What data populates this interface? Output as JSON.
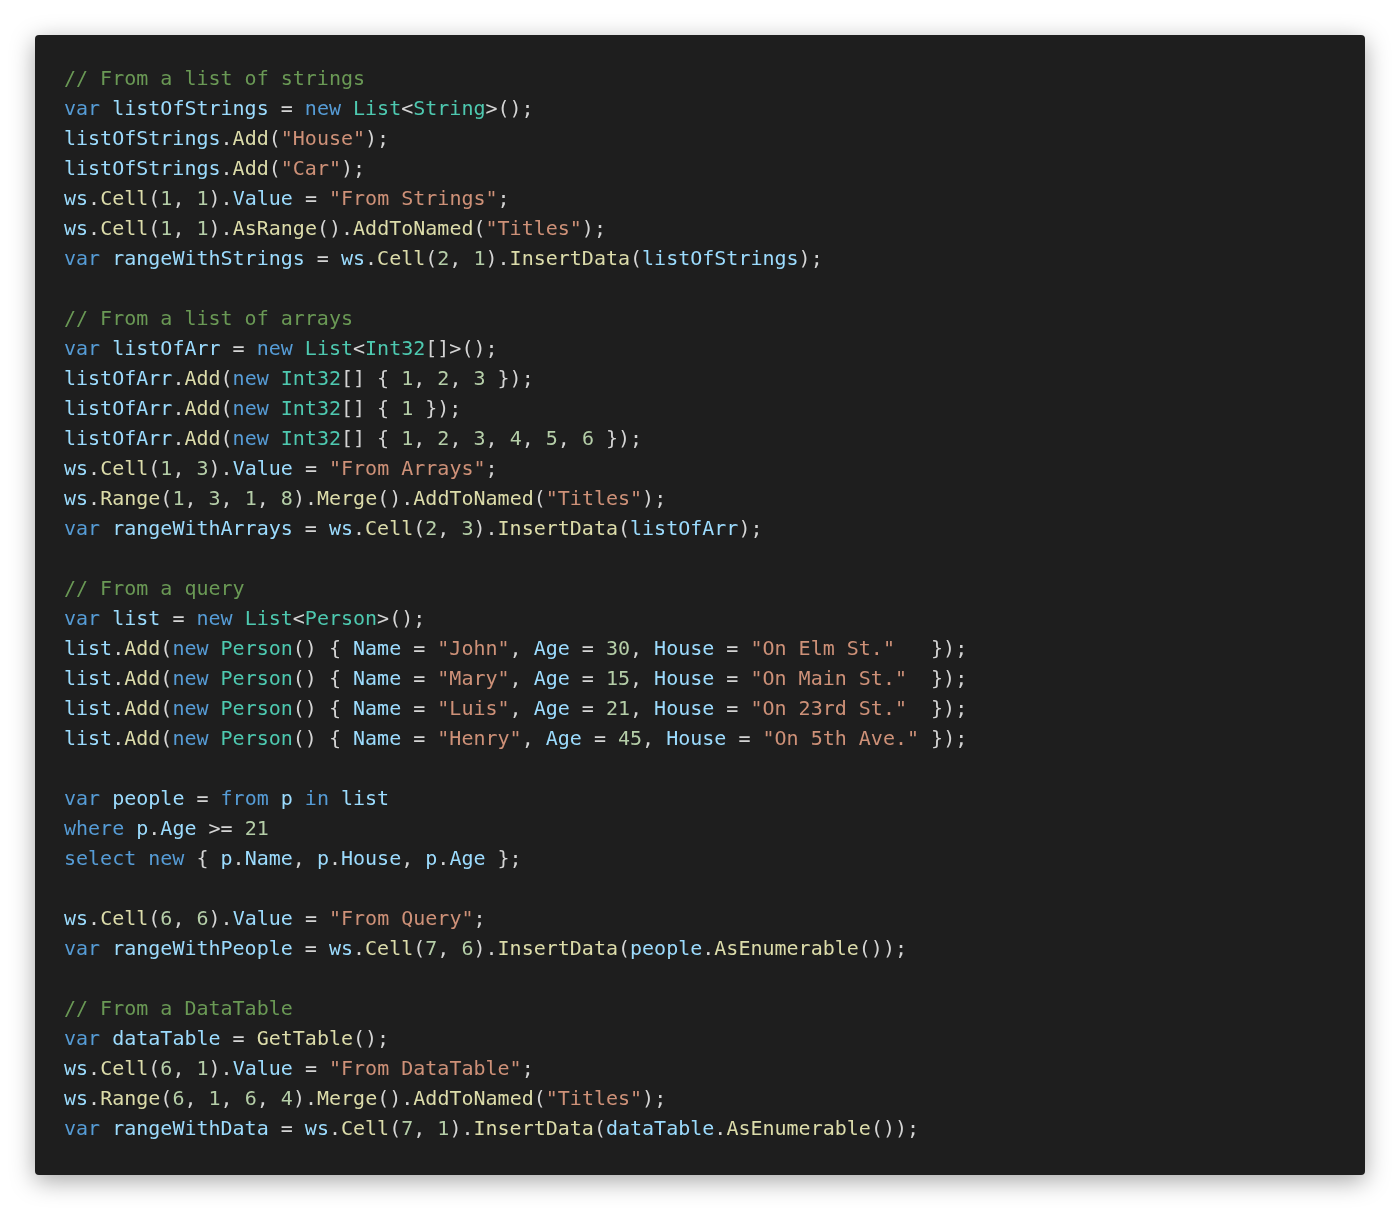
{
  "code_blocks": [
    {
      "lines": [
        [
          {
            "kind": "comment",
            "text": "// From a list of strings"
          }
        ],
        [
          {
            "kind": "keyword",
            "text": "var "
          },
          {
            "kind": "name",
            "text": "listOfStrings"
          },
          {
            "kind": "punct",
            "text": " = "
          },
          {
            "kind": "keyword",
            "text": "new "
          },
          {
            "kind": "type",
            "text": "List"
          },
          {
            "kind": "punct",
            "text": "<"
          },
          {
            "kind": "type",
            "text": "String"
          },
          {
            "kind": "punct",
            "text": ">();"
          }
        ],
        [
          {
            "kind": "name",
            "text": "listOfStrings"
          },
          {
            "kind": "punct",
            "text": "."
          },
          {
            "kind": "method",
            "text": "Add"
          },
          {
            "kind": "punct",
            "text": "("
          },
          {
            "kind": "string",
            "text": "\"House\""
          },
          {
            "kind": "punct",
            "text": ");"
          }
        ],
        [
          {
            "kind": "name",
            "text": "listOfStrings"
          },
          {
            "kind": "punct",
            "text": "."
          },
          {
            "kind": "method",
            "text": "Add"
          },
          {
            "kind": "punct",
            "text": "("
          },
          {
            "kind": "string",
            "text": "\"Car\""
          },
          {
            "kind": "punct",
            "text": ");"
          }
        ],
        [
          {
            "kind": "name",
            "text": "ws"
          },
          {
            "kind": "punct",
            "text": "."
          },
          {
            "kind": "method",
            "text": "Cell"
          },
          {
            "kind": "punct",
            "text": "("
          },
          {
            "kind": "number",
            "text": "1"
          },
          {
            "kind": "punct",
            "text": ", "
          },
          {
            "kind": "number",
            "text": "1"
          },
          {
            "kind": "punct",
            "text": ")."
          },
          {
            "kind": "name",
            "text": "Value"
          },
          {
            "kind": "punct",
            "text": " = "
          },
          {
            "kind": "string",
            "text": "\"From Strings\""
          },
          {
            "kind": "punct",
            "text": ";"
          }
        ],
        [
          {
            "kind": "name",
            "text": "ws"
          },
          {
            "kind": "punct",
            "text": "."
          },
          {
            "kind": "method",
            "text": "Cell"
          },
          {
            "kind": "punct",
            "text": "("
          },
          {
            "kind": "number",
            "text": "1"
          },
          {
            "kind": "punct",
            "text": ", "
          },
          {
            "kind": "number",
            "text": "1"
          },
          {
            "kind": "punct",
            "text": ")."
          },
          {
            "kind": "method",
            "text": "AsRange"
          },
          {
            "kind": "punct",
            "text": "()."
          },
          {
            "kind": "method",
            "text": "AddToNamed"
          },
          {
            "kind": "punct",
            "text": "("
          },
          {
            "kind": "string",
            "text": "\"Titles\""
          },
          {
            "kind": "punct",
            "text": ");"
          }
        ],
        [
          {
            "kind": "keyword",
            "text": "var "
          },
          {
            "kind": "name",
            "text": "rangeWithStrings"
          },
          {
            "kind": "punct",
            "text": " = "
          },
          {
            "kind": "name",
            "text": "ws"
          },
          {
            "kind": "punct",
            "text": "."
          },
          {
            "kind": "method",
            "text": "Cell"
          },
          {
            "kind": "punct",
            "text": "("
          },
          {
            "kind": "number",
            "text": "2"
          },
          {
            "kind": "punct",
            "text": ", "
          },
          {
            "kind": "number",
            "text": "1"
          },
          {
            "kind": "punct",
            "text": ")."
          },
          {
            "kind": "method",
            "text": "InsertData"
          },
          {
            "kind": "punct",
            "text": "("
          },
          {
            "kind": "name",
            "text": "listOfStrings"
          },
          {
            "kind": "punct",
            "text": ");"
          }
        ]
      ]
    },
    {
      "lines": [
        [
          {
            "kind": "comment",
            "text": "// From a list of arrays"
          }
        ],
        [
          {
            "kind": "keyword",
            "text": "var "
          },
          {
            "kind": "name",
            "text": "listOfArr"
          },
          {
            "kind": "punct",
            "text": " = "
          },
          {
            "kind": "keyword",
            "text": "new "
          },
          {
            "kind": "type",
            "text": "List"
          },
          {
            "kind": "punct",
            "text": "<"
          },
          {
            "kind": "type",
            "text": "Int32"
          },
          {
            "kind": "punct",
            "text": "[]>();"
          }
        ],
        [
          {
            "kind": "name",
            "text": "listOfArr"
          },
          {
            "kind": "punct",
            "text": "."
          },
          {
            "kind": "method",
            "text": "Add"
          },
          {
            "kind": "punct",
            "text": "("
          },
          {
            "kind": "keyword",
            "text": "new "
          },
          {
            "kind": "type",
            "text": "Int32"
          },
          {
            "kind": "punct",
            "text": "[] { "
          },
          {
            "kind": "number",
            "text": "1"
          },
          {
            "kind": "punct",
            "text": ", "
          },
          {
            "kind": "number",
            "text": "2"
          },
          {
            "kind": "punct",
            "text": ", "
          },
          {
            "kind": "number",
            "text": "3"
          },
          {
            "kind": "punct",
            "text": " });"
          }
        ],
        [
          {
            "kind": "name",
            "text": "listOfArr"
          },
          {
            "kind": "punct",
            "text": "."
          },
          {
            "kind": "method",
            "text": "Add"
          },
          {
            "kind": "punct",
            "text": "("
          },
          {
            "kind": "keyword",
            "text": "new "
          },
          {
            "kind": "type",
            "text": "Int32"
          },
          {
            "kind": "punct",
            "text": "[] { "
          },
          {
            "kind": "number",
            "text": "1"
          },
          {
            "kind": "punct",
            "text": " });"
          }
        ],
        [
          {
            "kind": "name",
            "text": "listOfArr"
          },
          {
            "kind": "punct",
            "text": "."
          },
          {
            "kind": "method",
            "text": "Add"
          },
          {
            "kind": "punct",
            "text": "("
          },
          {
            "kind": "keyword",
            "text": "new "
          },
          {
            "kind": "type",
            "text": "Int32"
          },
          {
            "kind": "punct",
            "text": "[] { "
          },
          {
            "kind": "number",
            "text": "1"
          },
          {
            "kind": "punct",
            "text": ", "
          },
          {
            "kind": "number",
            "text": "2"
          },
          {
            "kind": "punct",
            "text": ", "
          },
          {
            "kind": "number",
            "text": "3"
          },
          {
            "kind": "punct",
            "text": ", "
          },
          {
            "kind": "number",
            "text": "4"
          },
          {
            "kind": "punct",
            "text": ", "
          },
          {
            "kind": "number",
            "text": "5"
          },
          {
            "kind": "punct",
            "text": ", "
          },
          {
            "kind": "number",
            "text": "6"
          },
          {
            "kind": "punct",
            "text": " });"
          }
        ],
        [
          {
            "kind": "name",
            "text": "ws"
          },
          {
            "kind": "punct",
            "text": "."
          },
          {
            "kind": "method",
            "text": "Cell"
          },
          {
            "kind": "punct",
            "text": "("
          },
          {
            "kind": "number",
            "text": "1"
          },
          {
            "kind": "punct",
            "text": ", "
          },
          {
            "kind": "number",
            "text": "3"
          },
          {
            "kind": "punct",
            "text": ")."
          },
          {
            "kind": "name",
            "text": "Value"
          },
          {
            "kind": "punct",
            "text": " = "
          },
          {
            "kind": "string",
            "text": "\"From Arrays\""
          },
          {
            "kind": "punct",
            "text": ";"
          }
        ],
        [
          {
            "kind": "name",
            "text": "ws"
          },
          {
            "kind": "punct",
            "text": "."
          },
          {
            "kind": "method",
            "text": "Range"
          },
          {
            "kind": "punct",
            "text": "("
          },
          {
            "kind": "number",
            "text": "1"
          },
          {
            "kind": "punct",
            "text": ", "
          },
          {
            "kind": "number",
            "text": "3"
          },
          {
            "kind": "punct",
            "text": ", "
          },
          {
            "kind": "number",
            "text": "1"
          },
          {
            "kind": "punct",
            "text": ", "
          },
          {
            "kind": "number",
            "text": "8"
          },
          {
            "kind": "punct",
            "text": ")."
          },
          {
            "kind": "method",
            "text": "Merge"
          },
          {
            "kind": "punct",
            "text": "()."
          },
          {
            "kind": "method",
            "text": "AddToNamed"
          },
          {
            "kind": "punct",
            "text": "("
          },
          {
            "kind": "string",
            "text": "\"Titles\""
          },
          {
            "kind": "punct",
            "text": ");"
          }
        ],
        [
          {
            "kind": "keyword",
            "text": "var "
          },
          {
            "kind": "name",
            "text": "rangeWithArrays"
          },
          {
            "kind": "punct",
            "text": " = "
          },
          {
            "kind": "name",
            "text": "ws"
          },
          {
            "kind": "punct",
            "text": "."
          },
          {
            "kind": "method",
            "text": "Cell"
          },
          {
            "kind": "punct",
            "text": "("
          },
          {
            "kind": "number",
            "text": "2"
          },
          {
            "kind": "punct",
            "text": ", "
          },
          {
            "kind": "number",
            "text": "3"
          },
          {
            "kind": "punct",
            "text": ")."
          },
          {
            "kind": "method",
            "text": "InsertData"
          },
          {
            "kind": "punct",
            "text": "("
          },
          {
            "kind": "name",
            "text": "listOfArr"
          },
          {
            "kind": "punct",
            "text": ");"
          }
        ]
      ]
    },
    {
      "lines": [
        [
          {
            "kind": "comment",
            "text": "// From a query"
          }
        ],
        [
          {
            "kind": "keyword",
            "text": "var "
          },
          {
            "kind": "name",
            "text": "list"
          },
          {
            "kind": "punct",
            "text": " = "
          },
          {
            "kind": "keyword",
            "text": "new "
          },
          {
            "kind": "type",
            "text": "List"
          },
          {
            "kind": "punct",
            "text": "<"
          },
          {
            "kind": "type",
            "text": "Person"
          },
          {
            "kind": "punct",
            "text": ">();"
          }
        ],
        [
          {
            "kind": "name",
            "text": "list"
          },
          {
            "kind": "punct",
            "text": "."
          },
          {
            "kind": "method",
            "text": "Add"
          },
          {
            "kind": "punct",
            "text": "("
          },
          {
            "kind": "keyword",
            "text": "new "
          },
          {
            "kind": "type",
            "text": "Person"
          },
          {
            "kind": "punct",
            "text": "() { "
          },
          {
            "kind": "name",
            "text": "Name"
          },
          {
            "kind": "punct",
            "text": " = "
          },
          {
            "kind": "string",
            "text": "\"John\""
          },
          {
            "kind": "punct",
            "text": ", "
          },
          {
            "kind": "name",
            "text": "Age"
          },
          {
            "kind": "punct",
            "text": " = "
          },
          {
            "kind": "number",
            "text": "30"
          },
          {
            "kind": "punct",
            "text": ", "
          },
          {
            "kind": "name",
            "text": "House"
          },
          {
            "kind": "punct",
            "text": " = "
          },
          {
            "kind": "string",
            "text": "\"On Elm St.\""
          },
          {
            "kind": "punct",
            "text": "   });"
          }
        ],
        [
          {
            "kind": "name",
            "text": "list"
          },
          {
            "kind": "punct",
            "text": "."
          },
          {
            "kind": "method",
            "text": "Add"
          },
          {
            "kind": "punct",
            "text": "("
          },
          {
            "kind": "keyword",
            "text": "new "
          },
          {
            "kind": "type",
            "text": "Person"
          },
          {
            "kind": "punct",
            "text": "() { "
          },
          {
            "kind": "name",
            "text": "Name"
          },
          {
            "kind": "punct",
            "text": " = "
          },
          {
            "kind": "string",
            "text": "\"Mary\""
          },
          {
            "kind": "punct",
            "text": ", "
          },
          {
            "kind": "name",
            "text": "Age"
          },
          {
            "kind": "punct",
            "text": " = "
          },
          {
            "kind": "number",
            "text": "15"
          },
          {
            "kind": "punct",
            "text": ", "
          },
          {
            "kind": "name",
            "text": "House"
          },
          {
            "kind": "punct",
            "text": " = "
          },
          {
            "kind": "string",
            "text": "\"On Main St.\""
          },
          {
            "kind": "punct",
            "text": "  });"
          }
        ],
        [
          {
            "kind": "name",
            "text": "list"
          },
          {
            "kind": "punct",
            "text": "."
          },
          {
            "kind": "method",
            "text": "Add"
          },
          {
            "kind": "punct",
            "text": "("
          },
          {
            "kind": "keyword",
            "text": "new "
          },
          {
            "kind": "type",
            "text": "Person"
          },
          {
            "kind": "punct",
            "text": "() { "
          },
          {
            "kind": "name",
            "text": "Name"
          },
          {
            "kind": "punct",
            "text": " = "
          },
          {
            "kind": "string",
            "text": "\"Luis\""
          },
          {
            "kind": "punct",
            "text": ", "
          },
          {
            "kind": "name",
            "text": "Age"
          },
          {
            "kind": "punct",
            "text": " = "
          },
          {
            "kind": "number",
            "text": "21"
          },
          {
            "kind": "punct",
            "text": ", "
          },
          {
            "kind": "name",
            "text": "House"
          },
          {
            "kind": "punct",
            "text": " = "
          },
          {
            "kind": "string",
            "text": "\"On 23rd St.\""
          },
          {
            "kind": "punct",
            "text": "  });"
          }
        ],
        [
          {
            "kind": "name",
            "text": "list"
          },
          {
            "kind": "punct",
            "text": "."
          },
          {
            "kind": "method",
            "text": "Add"
          },
          {
            "kind": "punct",
            "text": "("
          },
          {
            "kind": "keyword",
            "text": "new "
          },
          {
            "kind": "type",
            "text": "Person"
          },
          {
            "kind": "punct",
            "text": "() { "
          },
          {
            "kind": "name",
            "text": "Name"
          },
          {
            "kind": "punct",
            "text": " = "
          },
          {
            "kind": "string",
            "text": "\"Henry\""
          },
          {
            "kind": "punct",
            "text": ", "
          },
          {
            "kind": "name",
            "text": "Age"
          },
          {
            "kind": "punct",
            "text": " = "
          },
          {
            "kind": "number",
            "text": "45"
          },
          {
            "kind": "punct",
            "text": ", "
          },
          {
            "kind": "name",
            "text": "House"
          },
          {
            "kind": "punct",
            "text": " = "
          },
          {
            "kind": "string",
            "text": "\"On 5th Ave.\""
          },
          {
            "kind": "punct",
            "text": " });"
          }
        ]
      ]
    },
    {
      "lines": [
        [
          {
            "kind": "keyword",
            "text": "var "
          },
          {
            "kind": "name",
            "text": "people"
          },
          {
            "kind": "punct",
            "text": " = "
          },
          {
            "kind": "keyword",
            "text": "from "
          },
          {
            "kind": "name",
            "text": "p "
          },
          {
            "kind": "keyword",
            "text": "in "
          },
          {
            "kind": "name",
            "text": "list"
          }
        ],
        [
          {
            "kind": "keyword",
            "text": "where "
          },
          {
            "kind": "name",
            "text": "p"
          },
          {
            "kind": "punct",
            "text": "."
          },
          {
            "kind": "name",
            "text": "Age"
          },
          {
            "kind": "punct",
            "text": " >= "
          },
          {
            "kind": "number",
            "text": "21"
          }
        ],
        [
          {
            "kind": "keyword",
            "text": "select new "
          },
          {
            "kind": "punct",
            "text": "{ "
          },
          {
            "kind": "name",
            "text": "p"
          },
          {
            "kind": "punct",
            "text": "."
          },
          {
            "kind": "name",
            "text": "Name"
          },
          {
            "kind": "punct",
            "text": ", "
          },
          {
            "kind": "name",
            "text": "p"
          },
          {
            "kind": "punct",
            "text": "."
          },
          {
            "kind": "name",
            "text": "House"
          },
          {
            "kind": "punct",
            "text": ", "
          },
          {
            "kind": "name",
            "text": "p"
          },
          {
            "kind": "punct",
            "text": "."
          },
          {
            "kind": "name",
            "text": "Age"
          },
          {
            "kind": "punct",
            "text": " };"
          }
        ]
      ]
    },
    {
      "lines": [
        [
          {
            "kind": "name",
            "text": "ws"
          },
          {
            "kind": "punct",
            "text": "."
          },
          {
            "kind": "method",
            "text": "Cell"
          },
          {
            "kind": "punct",
            "text": "("
          },
          {
            "kind": "number",
            "text": "6"
          },
          {
            "kind": "punct",
            "text": ", "
          },
          {
            "kind": "number",
            "text": "6"
          },
          {
            "kind": "punct",
            "text": ")."
          },
          {
            "kind": "name",
            "text": "Value"
          },
          {
            "kind": "punct",
            "text": " = "
          },
          {
            "kind": "string",
            "text": "\"From Query\""
          },
          {
            "kind": "punct",
            "text": ";"
          }
        ],
        [
          {
            "kind": "keyword",
            "text": "var "
          },
          {
            "kind": "name",
            "text": "rangeWithPeople"
          },
          {
            "kind": "punct",
            "text": " = "
          },
          {
            "kind": "name",
            "text": "ws"
          },
          {
            "kind": "punct",
            "text": "."
          },
          {
            "kind": "method",
            "text": "Cell"
          },
          {
            "kind": "punct",
            "text": "("
          },
          {
            "kind": "number",
            "text": "7"
          },
          {
            "kind": "punct",
            "text": ", "
          },
          {
            "kind": "number",
            "text": "6"
          },
          {
            "kind": "punct",
            "text": ")."
          },
          {
            "kind": "method",
            "text": "InsertData"
          },
          {
            "kind": "punct",
            "text": "("
          },
          {
            "kind": "name",
            "text": "people"
          },
          {
            "kind": "punct",
            "text": "."
          },
          {
            "kind": "method",
            "text": "AsEnumerable"
          },
          {
            "kind": "punct",
            "text": "());"
          }
        ]
      ]
    },
    {
      "lines": [
        [
          {
            "kind": "comment",
            "text": "// From a DataTable"
          }
        ],
        [
          {
            "kind": "keyword",
            "text": "var "
          },
          {
            "kind": "name",
            "text": "dataTable"
          },
          {
            "kind": "punct",
            "text": " = "
          },
          {
            "kind": "method",
            "text": "GetTable"
          },
          {
            "kind": "punct",
            "text": "();"
          }
        ],
        [
          {
            "kind": "name",
            "text": "ws"
          },
          {
            "kind": "punct",
            "text": "."
          },
          {
            "kind": "method",
            "text": "Cell"
          },
          {
            "kind": "punct",
            "text": "("
          },
          {
            "kind": "number",
            "text": "6"
          },
          {
            "kind": "punct",
            "text": ", "
          },
          {
            "kind": "number",
            "text": "1"
          },
          {
            "kind": "punct",
            "text": ")."
          },
          {
            "kind": "name",
            "text": "Value"
          },
          {
            "kind": "punct",
            "text": " = "
          },
          {
            "kind": "string",
            "text": "\"From DataTable\""
          },
          {
            "kind": "punct",
            "text": ";"
          }
        ],
        [
          {
            "kind": "name",
            "text": "ws"
          },
          {
            "kind": "punct",
            "text": "."
          },
          {
            "kind": "method",
            "text": "Range"
          },
          {
            "kind": "punct",
            "text": "("
          },
          {
            "kind": "number",
            "text": "6"
          },
          {
            "kind": "punct",
            "text": ", "
          },
          {
            "kind": "number",
            "text": "1"
          },
          {
            "kind": "punct",
            "text": ", "
          },
          {
            "kind": "number",
            "text": "6"
          },
          {
            "kind": "punct",
            "text": ", "
          },
          {
            "kind": "number",
            "text": "4"
          },
          {
            "kind": "punct",
            "text": ")."
          },
          {
            "kind": "method",
            "text": "Merge"
          },
          {
            "kind": "punct",
            "text": "()."
          },
          {
            "kind": "method",
            "text": "AddToNamed"
          },
          {
            "kind": "punct",
            "text": "("
          },
          {
            "kind": "string",
            "text": "\"Titles\""
          },
          {
            "kind": "punct",
            "text": ");"
          }
        ],
        [
          {
            "kind": "keyword",
            "text": "var "
          },
          {
            "kind": "name",
            "text": "rangeWithData"
          },
          {
            "kind": "punct",
            "text": " = "
          },
          {
            "kind": "name",
            "text": "ws"
          },
          {
            "kind": "punct",
            "text": "."
          },
          {
            "kind": "method",
            "text": "Cell"
          },
          {
            "kind": "punct",
            "text": "("
          },
          {
            "kind": "number",
            "text": "7"
          },
          {
            "kind": "punct",
            "text": ", "
          },
          {
            "kind": "number",
            "text": "1"
          },
          {
            "kind": "punct",
            "text": ")."
          },
          {
            "kind": "method",
            "text": "InsertData"
          },
          {
            "kind": "punct",
            "text": "("
          },
          {
            "kind": "name",
            "text": "dataTable"
          },
          {
            "kind": "punct",
            "text": "."
          },
          {
            "kind": "method",
            "text": "AsEnumerable"
          },
          {
            "kind": "punct",
            "text": "());"
          }
        ]
      ]
    }
  ]
}
